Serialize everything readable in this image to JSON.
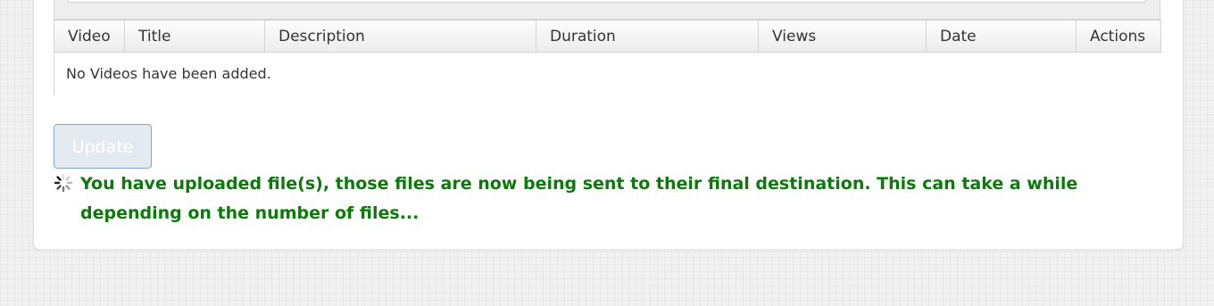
{
  "table": {
    "columns": [
      "Video",
      "Title",
      "Description",
      "Duration",
      "Views",
      "Date",
      "Actions"
    ],
    "empty_message": "No Videos have been added."
  },
  "form": {
    "update_label": "Update"
  },
  "status": {
    "message": "You have uploaded file(s), those files are now being sent to their final destination. This can take a while depending on the number of files...",
    "color": "#0b7a0b"
  },
  "icons": {
    "spinner": "loading-spinner-icon"
  }
}
